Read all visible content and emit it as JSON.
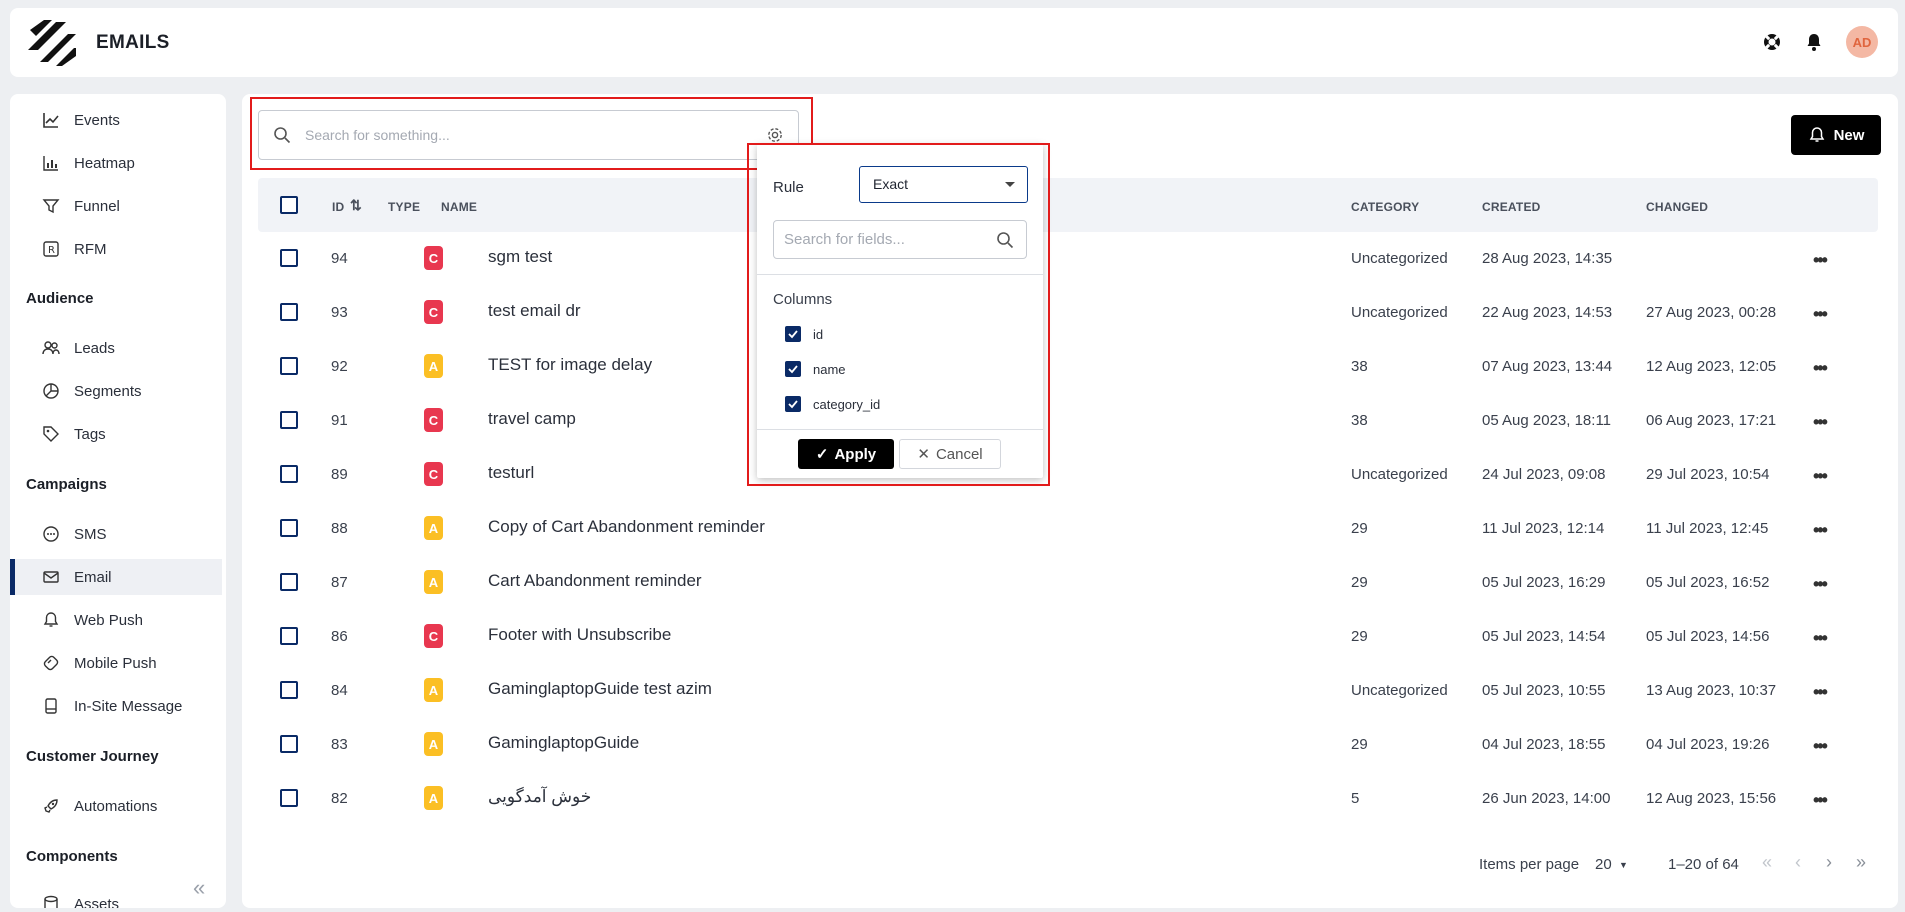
{
  "header": {
    "title": "EMAILS",
    "avatar_initials": "AD"
  },
  "sidebar": {
    "items": [
      {
        "label": "Events",
        "icon": "chart-line-icon"
      },
      {
        "label": "Heatmap",
        "icon": "bar-chart-icon"
      },
      {
        "label": "Funnel",
        "icon": "funnel-icon"
      },
      {
        "label": "RFM",
        "icon": "rfm-icon"
      }
    ],
    "sections": [
      {
        "title": "Audience",
        "items": [
          {
            "label": "Leads"
          },
          {
            "label": "Segments"
          },
          {
            "label": "Tags"
          }
        ]
      },
      {
        "title": "Campaigns",
        "items": [
          {
            "label": "SMS"
          },
          {
            "label": "Email",
            "active": true
          },
          {
            "label": "Web Push"
          },
          {
            "label": "Mobile Push"
          },
          {
            "label": "In-Site Message"
          }
        ]
      },
      {
        "title": "Customer Journey",
        "items": [
          {
            "label": "Automations"
          }
        ]
      },
      {
        "title": "Components",
        "items": [
          {
            "label": "Assets"
          }
        ]
      }
    ]
  },
  "search": {
    "placeholder": "Search for something..."
  },
  "toolbar": {
    "new_label": "New"
  },
  "table": {
    "columns": {
      "id": "ID",
      "type": "TYPE",
      "name": "NAME",
      "category": "CATEGORY",
      "created": "CREATED",
      "changed": "CHANGED"
    },
    "rows": [
      {
        "id": "94",
        "type": "C",
        "name": "sgm test",
        "category": "Uncategorized",
        "created": "28 Aug 2023, 14:35",
        "changed": ""
      },
      {
        "id": "93",
        "type": "C",
        "name": "test email dr",
        "category": "Uncategorized",
        "created": "22 Aug 2023, 14:53",
        "changed": "27 Aug 2023, 00:28"
      },
      {
        "id": "92",
        "type": "A",
        "name": "TEST for image delay",
        "category": "38",
        "created": "07 Aug 2023, 13:44",
        "changed": "12 Aug 2023, 12:05"
      },
      {
        "id": "91",
        "type": "C",
        "name": "travel camp",
        "category": "38",
        "created": "05 Aug 2023, 18:11",
        "changed": "06 Aug 2023, 17:21"
      },
      {
        "id": "89",
        "type": "C",
        "name": "testurl",
        "category": "Uncategorized",
        "created": "24 Jul 2023, 09:08",
        "changed": "29 Jul 2023, 10:54"
      },
      {
        "id": "88",
        "type": "A",
        "name": "Copy of Cart Abandonment reminder",
        "category": "29",
        "created": "11 Jul 2023, 12:14",
        "changed": "11 Jul 2023, 12:45"
      },
      {
        "id": "87",
        "type": "A",
        "name": "Cart Abandonment reminder",
        "category": "29",
        "created": "05 Jul 2023, 16:29",
        "changed": "05 Jul 2023, 16:52"
      },
      {
        "id": "86",
        "type": "C",
        "name": "Footer with Unsubscribe",
        "category": "29",
        "created": "05 Jul 2023, 14:54",
        "changed": "05 Jul 2023, 14:56"
      },
      {
        "id": "84",
        "type": "A",
        "name": "GaminglaptopGuide test azim",
        "category": "Uncategorized",
        "created": "05 Jul 2023, 10:55",
        "changed": "13 Aug 2023, 10:37"
      },
      {
        "id": "83",
        "type": "A",
        "name": "GaminglaptopGuide",
        "category": "29",
        "created": "04 Jul 2023, 18:55",
        "changed": "04 Jul 2023, 19:26"
      },
      {
        "id": "82",
        "type": "A",
        "name": "خوش آمدگویی",
        "category": "5",
        "created": "26 Jun 2023, 14:00",
        "changed": "12 Aug 2023, 15:56"
      }
    ]
  },
  "pagination": {
    "items_per_page_label": "Items per page",
    "page_size": "20",
    "range": "1–20 of 64"
  },
  "popup": {
    "rule_label": "Rule",
    "rule_value": "Exact",
    "field_search_placeholder": "Search for fields...",
    "columns_label": "Columns",
    "columns": [
      "id",
      "name",
      "category_id"
    ],
    "apply_label": "Apply",
    "cancel_label": "Cancel"
  }
}
